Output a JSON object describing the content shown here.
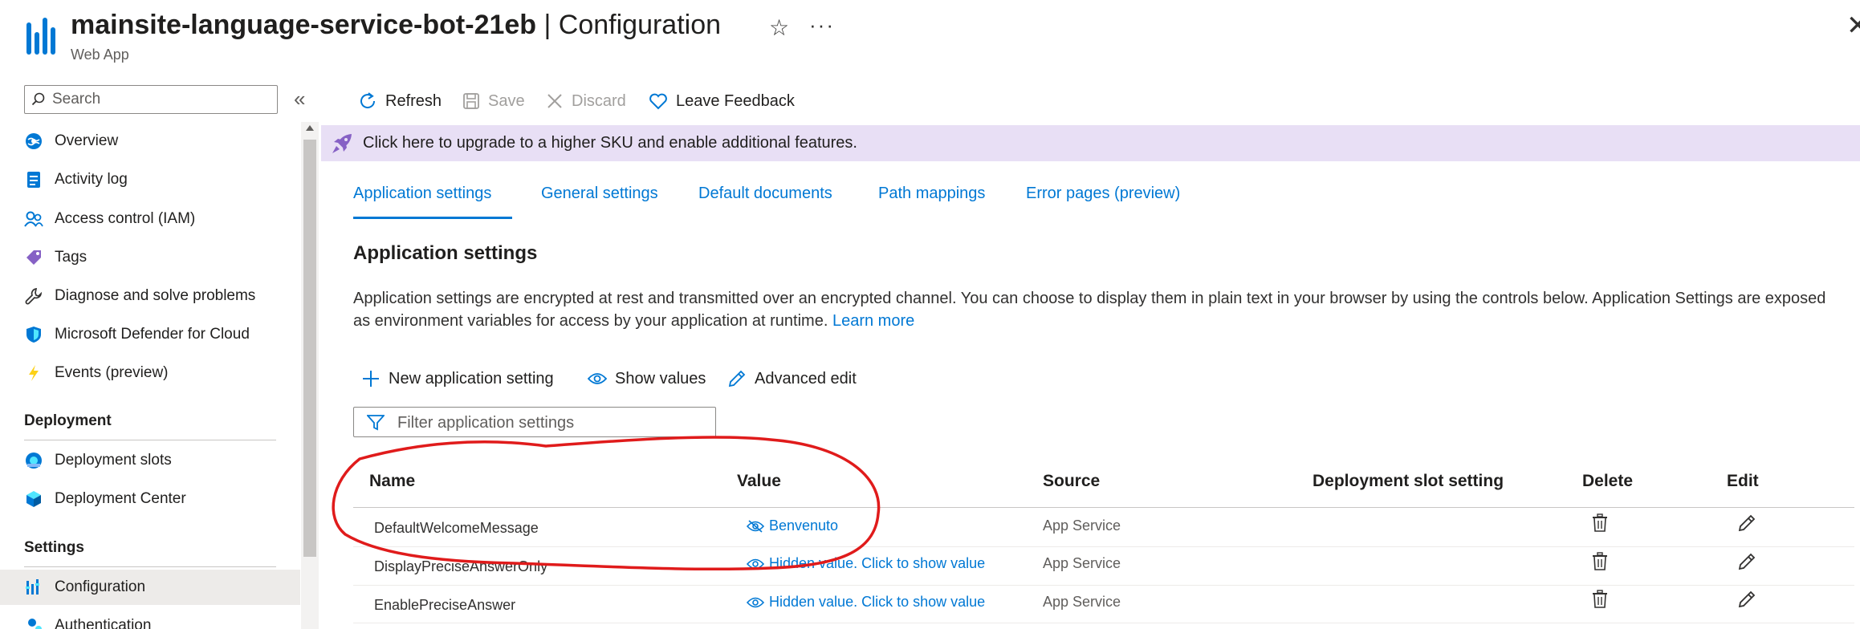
{
  "header": {
    "resource_name": "mainsite-language-service-bot-21eb",
    "separator": " | ",
    "page_name": "Configuration",
    "subtitle": "Web App",
    "favorite_icon": "star-icon",
    "more_icon": "more-icon",
    "close_icon": "close-icon"
  },
  "sidebar": {
    "search_placeholder": "Search",
    "items": [
      {
        "label": "Overview",
        "icon": "globe-icon"
      },
      {
        "label": "Activity log",
        "icon": "log-icon"
      },
      {
        "label": "Access control (IAM)",
        "icon": "people-icon"
      },
      {
        "label": "Tags",
        "icon": "tag-icon"
      },
      {
        "label": "Diagnose and solve problems",
        "icon": "wrench-icon"
      },
      {
        "label": "Microsoft Defender for Cloud",
        "icon": "shield-icon"
      },
      {
        "label": "Events (preview)",
        "icon": "lightning-icon"
      }
    ],
    "deployment_section": "Deployment",
    "deployment_items": [
      {
        "label": "Deployment slots",
        "icon": "slots-icon"
      },
      {
        "label": "Deployment Center",
        "icon": "cube-icon"
      }
    ],
    "settings_section": "Settings",
    "settings_items": [
      {
        "label": "Configuration",
        "icon": "config-icon",
        "active": true
      },
      {
        "label": "Authentication",
        "icon": "user-icon"
      }
    ]
  },
  "toolbar": {
    "refresh": "Refresh",
    "save": "Save",
    "discard": "Discard",
    "feedback": "Leave Feedback"
  },
  "banner": {
    "text": "Click here to upgrade to a higher SKU and enable additional features."
  },
  "tabs": [
    {
      "label": "Application settings",
      "active": true
    },
    {
      "label": "General settings"
    },
    {
      "label": "Default documents"
    },
    {
      "label": "Path mappings"
    },
    {
      "label": "Error pages (preview)"
    }
  ],
  "section": {
    "title": "Application settings",
    "description": "Application settings are encrypted at rest and transmitted over an encrypted channel. You can choose to display them in plain text in your browser by using the controls below. Application Settings are exposed as environment variables for access by your application at runtime.",
    "learn_more": "Learn more"
  },
  "actions": {
    "new_setting": "New application setting",
    "show_values": "Show values",
    "advanced_edit": "Advanced edit",
    "filter_placeholder": "Filter application settings"
  },
  "table": {
    "columns": [
      "Name",
      "Value",
      "Source",
      "Deployment slot setting",
      "Delete",
      "Edit"
    ],
    "rows": [
      {
        "name": "DefaultWelcomeMessage",
        "value": "Benvenuto",
        "value_icon": "eye-hidden-icon",
        "source": "App Service"
      },
      {
        "name": "DisplayPreciseAnswerOnly",
        "value": "Hidden value. Click to show value",
        "value_icon": "eye-icon",
        "source": "App Service"
      },
      {
        "name": "EnablePreciseAnswer",
        "value": "Hidden value. Click to show value",
        "value_icon": "eye-icon",
        "source": "App Service"
      }
    ]
  },
  "colors": {
    "accent": "#0078d4",
    "banner_bg": "#e8dff5",
    "annotation": "#e01b1b"
  }
}
